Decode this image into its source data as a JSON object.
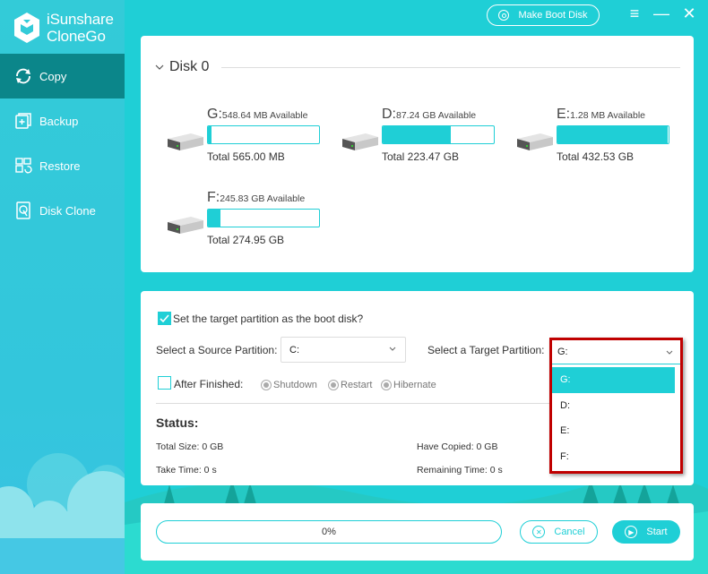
{
  "app": {
    "name_line1": "iSunshare",
    "name_line2": "CloneGo",
    "make_boot_disk": "Make Boot Disk",
    "menu_icon": "≡",
    "minimize_icon": "—",
    "close_icon": "✕"
  },
  "sidebar": {
    "items": [
      {
        "label": "Copy",
        "icon": "copy-sync-icon",
        "active": true
      },
      {
        "label": "Backup",
        "icon": "backup-icon",
        "active": false
      },
      {
        "label": "Restore",
        "icon": "restore-icon",
        "active": false
      },
      {
        "label": "Disk Clone",
        "icon": "disk-clone-icon",
        "active": false
      }
    ]
  },
  "disk": {
    "title": "Disk 0",
    "partitions": [
      {
        "letter": "G:",
        "available": "548.64 MB Available",
        "total": "Total 565.00 MB",
        "used_fraction": 0.03
      },
      {
        "letter": "D:",
        "available": "87.24 GB Available",
        "total": "Total 223.47 GB",
        "used_fraction": 0.61
      },
      {
        "letter": "E:",
        "available": "1.28 MB Available",
        "total": "Total 432.53 GB",
        "used_fraction": 0.99
      },
      {
        "letter": "F:",
        "available": "245.83 GB Available",
        "total": "Total 274.95 GB",
        "used_fraction": 0.11
      }
    ]
  },
  "options": {
    "boot_disk_label": "Set the target partition as the boot disk?",
    "boot_disk_checked": true,
    "source_label": "Select a Source Partition:",
    "source_value": "C:",
    "target_label": "Select a Target Partition:",
    "target_value": "G:",
    "target_options": [
      "G:",
      "D:",
      "E:",
      "F:"
    ],
    "after_finished_label": "After Finished:",
    "after_finished_checked": false,
    "radios": [
      "Shutdown",
      "Restart",
      "Hibernate"
    ]
  },
  "status": {
    "title": "Status:",
    "total_size": "Total Size: 0 GB",
    "have_copied": "Have Copied: 0 GB",
    "take_time": "Take Time: 0 s",
    "remaining_time": "Remaining Time: 0 s"
  },
  "footer": {
    "progress_text": "0%",
    "progress_value": 0,
    "cancel_label": "Cancel",
    "start_label": "Start"
  },
  "colors": {
    "accent": "#1fcfd6",
    "sidebar_active": "#0b868a",
    "highlight_frame": "#c00000"
  }
}
